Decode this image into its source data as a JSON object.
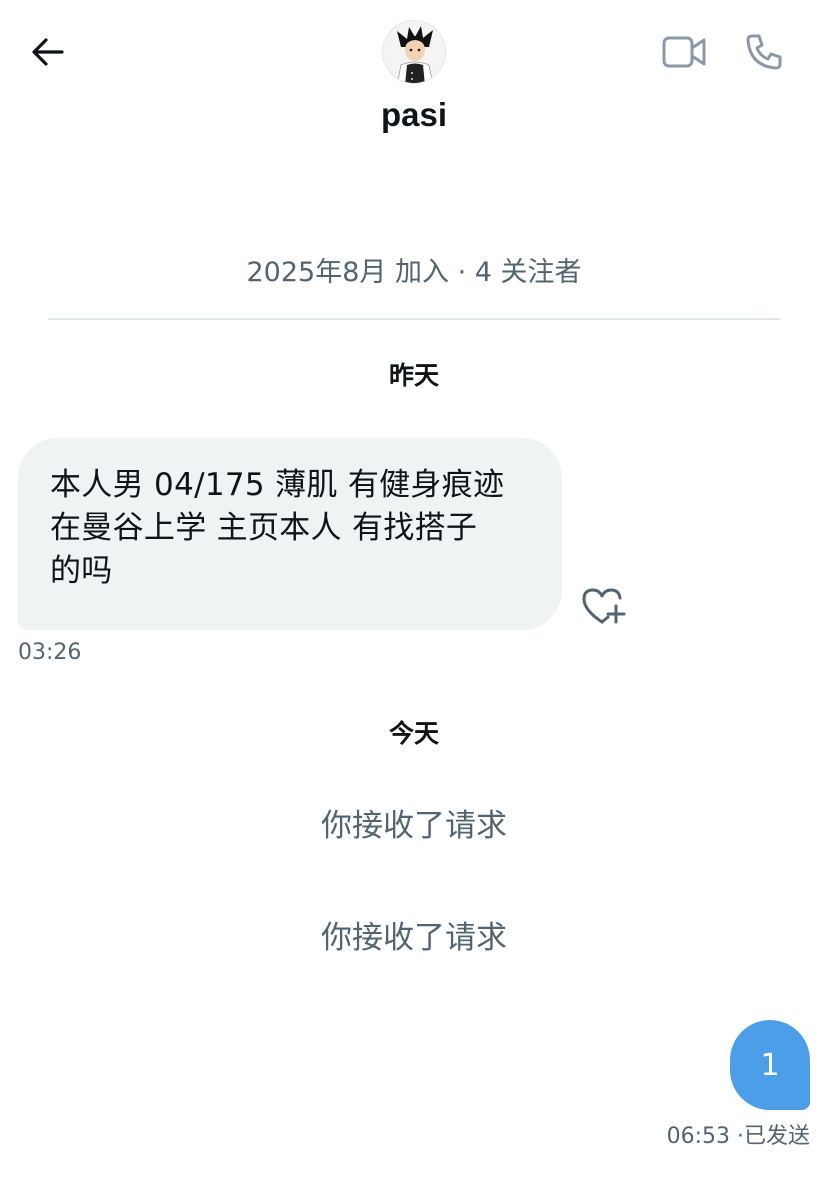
{
  "header": {
    "back_icon": "arrow-left-icon",
    "username": "pasi",
    "avatar_desc": "avatar",
    "video_icon": "video-camera-icon",
    "phone_icon": "phone-icon"
  },
  "profile_meta": {
    "joined": "2025年8月 加入",
    "separator": "·",
    "followers": "4 关注者"
  },
  "conversation": {
    "day_yesterday": "昨天",
    "incoming": {
      "lines": [
        "本人男 04/175 薄肌 有健身痕迹",
        "在曼谷上学 主页本人 有找搭子",
        "的吗"
      ],
      "time": "03:26",
      "react_icon": "heart-plus-icon"
    },
    "day_today": "今天",
    "system_messages": [
      "你接收了请求",
      "你接收了请求"
    ],
    "outgoing": {
      "text": "1",
      "time": "06:53",
      "status": "已发送"
    }
  },
  "colors": {
    "outgoing_bubble": "#4c9ee8",
    "incoming_bubble": "#eff3f4",
    "secondary_text": "#536471",
    "primary_text": "#0f1419"
  }
}
